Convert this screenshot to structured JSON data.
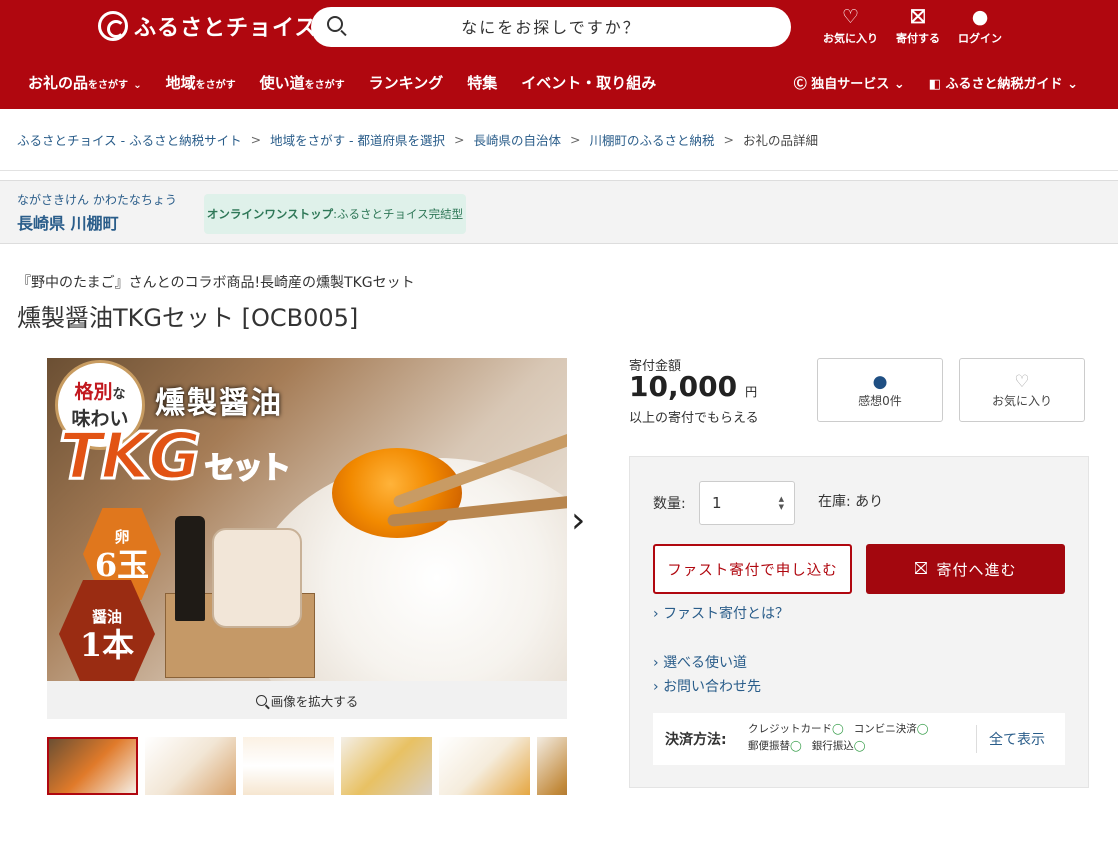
{
  "header": {
    "logo_text": "ふるさとチョイス",
    "search_placeholder": "なにをお探しですか？",
    "icons": [
      {
        "label": "お気に入り",
        "icon": "heart-icon"
      },
      {
        "label": "寄付する",
        "icon": "donate-icon"
      },
      {
        "label": "ログイン",
        "icon": "user-icon"
      }
    ],
    "nav": [
      {
        "main": "お礼の品",
        "sub": "をさがす",
        "chevron": true
      },
      {
        "main": "地域",
        "sub": "をさがす",
        "chevron": false
      },
      {
        "main": "使い道",
        "sub": "をさがす",
        "chevron": false
      },
      {
        "main": "ランキング",
        "sub": "",
        "chevron": false
      },
      {
        "main": "特集",
        "sub": "",
        "chevron": false
      },
      {
        "main": "イベント・取り組み",
        "sub": "",
        "chevron": false
      }
    ],
    "nav_right": [
      {
        "label": "独自サービス",
        "icon": "choice-logo-icon"
      },
      {
        "label": "ふるさと納税ガイド",
        "icon": "guide-book-icon"
      }
    ]
  },
  "breadcrumb": [
    "ふるさとチョイス - ふるさと納税サイト",
    "地域をさがす - 都道府県を選択",
    "長崎県の自治体",
    "川棚町のふるさと納税",
    "お礼の品詳細"
  ],
  "municipality": {
    "kana": "ながさきけん かわたなちょう",
    "name": "長崎県 川棚町",
    "badge_bold": "オンラインワンストップ",
    "badge_rest": ":ふるさとチョイス完結型"
  },
  "product": {
    "subtitle": "『野中のたまご』さんとのコラボ商品!長崎産の燻製TKGセット",
    "title": "燻製醤油TKGセット [OCB005]",
    "image": {
      "tag_line1": "格別",
      "tag_line1b": "な",
      "tag_line2": "味わい",
      "heading": "燻製醤油",
      "tkg": "TKG",
      "tkg_suffix": "セット",
      "egg_label": "卵",
      "egg_count": "6玉",
      "soy_label": "醤油",
      "soy_count": "1本"
    },
    "zoom_label": "画像を拡大する"
  },
  "donation": {
    "label": "寄付金額",
    "amount": "10,000",
    "unit": "円",
    "note": "以上の寄付でもらえる",
    "review_button": "感想0件",
    "favorite_button": "お気に入り",
    "qty_label": "数量:",
    "qty_value": "1",
    "stock_label": "在庫:",
    "stock_value": "あり",
    "fast_button": "ファスト寄付で申し込む",
    "proceed_button": "寄付へ進む",
    "links": [
      "ファスト寄付とは？",
      "選べる使い道",
      "お問い合わせ先"
    ],
    "payment_label": "決済方法:",
    "payment_methods": [
      "クレジットカード",
      "コンビニ決済",
      "郵便振替",
      "銀行振込"
    ],
    "payment_show_all": "全て表示"
  },
  "colors": {
    "brand_red": "#b0070f",
    "link_blue": "#2a5d8a",
    "ok_green": "#2f9a43"
  }
}
